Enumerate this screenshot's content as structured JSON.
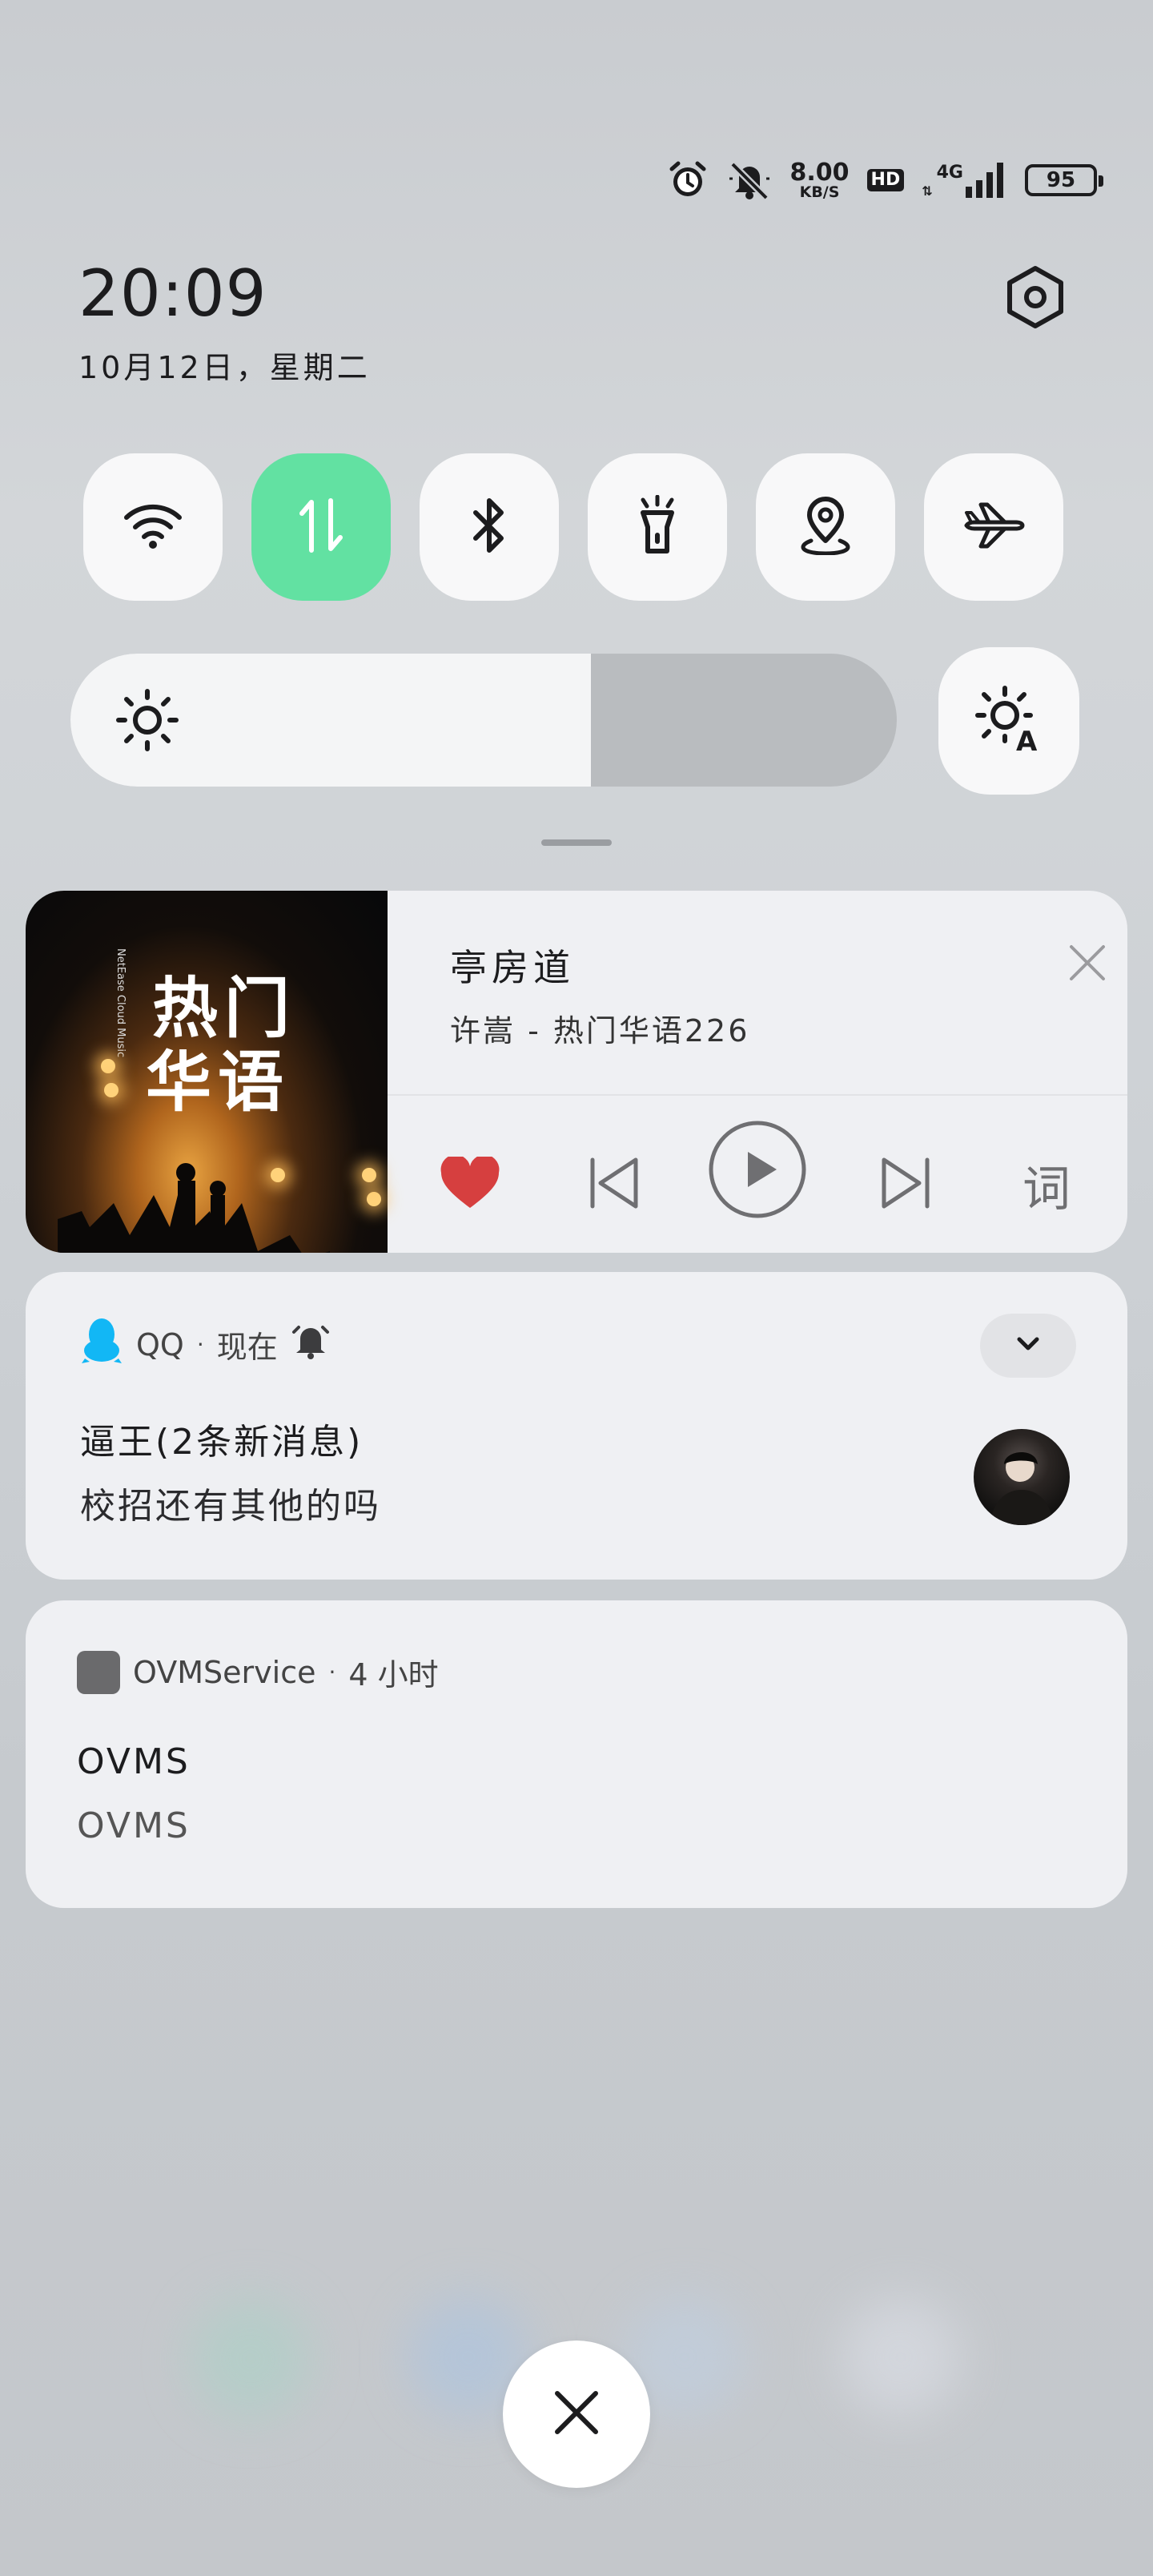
{
  "status_bar": {
    "net_speed_value": "8.00",
    "net_speed_unit": "KB/S",
    "hd_label": "HD",
    "network_type": "4G",
    "battery_level": "95",
    "icons": [
      "alarm-icon",
      "mute-icon",
      "signal-icon"
    ]
  },
  "header": {
    "time": "20:09",
    "date": "10月12日，星期二",
    "settings_icon": "gear-icon"
  },
  "quick_toggles": [
    {
      "name": "wifi",
      "icon": "wifi-icon",
      "active": false
    },
    {
      "name": "mobile-data",
      "icon": "data-arrows-icon",
      "active": true
    },
    {
      "name": "bluetooth",
      "icon": "bluetooth-icon",
      "active": false
    },
    {
      "name": "flashlight",
      "icon": "flashlight-icon",
      "active": false
    },
    {
      "name": "location",
      "icon": "location-icon",
      "active": false
    },
    {
      "name": "airplane",
      "icon": "airplane-icon",
      "active": false
    }
  ],
  "brightness": {
    "level_fraction": 0.63,
    "auto_icon": "auto-brightness-icon"
  },
  "music": {
    "album_title_line1": "热门",
    "album_title_line2": "华语",
    "album_small_text": "NetEase Cloud Music",
    "song_title": "亭房道",
    "artist_line": "许嵩 - 热门华语226",
    "lyric_label": "词",
    "liked": true
  },
  "qq_notification": {
    "app_name": "QQ",
    "separator": "·",
    "time": "现在",
    "title": "逼王(2条新消息)",
    "body": "校招还有其他的吗"
  },
  "ovm_notification": {
    "app_name": "OVMService",
    "separator": "·",
    "time": "4 小时",
    "title": "OVMS",
    "body": "OVMS"
  },
  "colors": {
    "active_toggle": "#62e1a2",
    "heart": "#d63f3f",
    "qq_blue": "#12b7f5"
  }
}
